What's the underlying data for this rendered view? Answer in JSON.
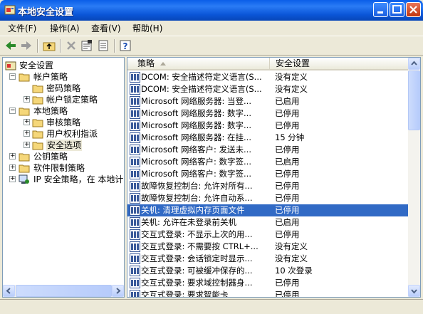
{
  "window": {
    "title": "本地安全设置"
  },
  "menu": [
    "文件(F)",
    "操作(A)",
    "查看(V)",
    "帮助(H)"
  ],
  "toolbar_icons": [
    "back-icon",
    "forward-icon",
    "up-folder-icon",
    "delete-icon",
    "properties-icon",
    "export-list-icon",
    "help-icon"
  ],
  "tree": [
    {
      "label": "安全设置",
      "level": 0,
      "expander": "",
      "icon": "security-settings-icon"
    },
    {
      "label": "帐户策略",
      "level": 1,
      "expander": "−",
      "icon": "folder-icon"
    },
    {
      "label": "密码策略",
      "level": 2,
      "expander": "",
      "icon": "folder-icon"
    },
    {
      "label": "帐户锁定策略",
      "level": 2,
      "expander": "+",
      "icon": "folder-icon"
    },
    {
      "label": "本地策略",
      "level": 1,
      "expander": "−",
      "icon": "folder-icon"
    },
    {
      "label": "审核策略",
      "level": 2,
      "expander": "+",
      "icon": "folder-icon"
    },
    {
      "label": "用户权利指派",
      "level": 2,
      "expander": "+",
      "icon": "folder-icon"
    },
    {
      "label": "安全选项",
      "level": 2,
      "expander": "+",
      "icon": "folder-icon"
    },
    {
      "label": "公钥策略",
      "level": 1,
      "expander": "+",
      "icon": "folder-icon"
    },
    {
      "label": "软件限制策略",
      "level": 1,
      "expander": "+",
      "icon": "folder-icon"
    },
    {
      "label": "IP 安全策略，在 本地计",
      "level": 1,
      "expander": "+",
      "icon": "ip-security-icon"
    }
  ],
  "list": {
    "columns": [
      "策略",
      "安全设置"
    ],
    "rows": [
      {
        "policy": "DCOM: 安全描述符定义语言(S...",
        "setting": "没有定义"
      },
      {
        "policy": "DCOM: 安全描述符定义语言(S...",
        "setting": "没有定义"
      },
      {
        "policy": "Microsoft 网络服务器: 当登...",
        "setting": "已启用"
      },
      {
        "policy": "Microsoft 网络服务器: 数字...",
        "setting": "已停用"
      },
      {
        "policy": "Microsoft 网络服务器: 数字...",
        "setting": "已停用"
      },
      {
        "policy": "Microsoft 网络服务器: 在挂...",
        "setting": "15 分钟"
      },
      {
        "policy": "Microsoft 网络客户: 发送未...",
        "setting": "已停用"
      },
      {
        "policy": "Microsoft 网络客户: 数字签...",
        "setting": "已启用"
      },
      {
        "policy": "Microsoft 网络客户: 数字签...",
        "setting": "已停用"
      },
      {
        "policy": "故障恢复控制台: 允许对所有...",
        "setting": "已停用"
      },
      {
        "policy": "故障恢复控制台: 允许自动系...",
        "setting": "已停用"
      },
      {
        "policy": "关机: 清理虚拟内存页面文件",
        "setting": "已停用",
        "selected": true
      },
      {
        "policy": "关机: 允许在未登录前关机",
        "setting": "已启用"
      },
      {
        "policy": "交互式登录: 不显示上次的用...",
        "setting": "已停用"
      },
      {
        "policy": "交互式登录: 不需要按 CTRL+...",
        "setting": "没有定义"
      },
      {
        "policy": "交互式登录: 会话锁定时显示...",
        "setting": "没有定义"
      },
      {
        "policy": "交互式登录: 可被缓冲保存的...",
        "setting": "10 次登录"
      },
      {
        "policy": "交互式登录: 要求域控制器身...",
        "setting": "已停用"
      },
      {
        "policy": "交互式登录: 要求智能卡",
        "setting": "已停用"
      }
    ]
  }
}
